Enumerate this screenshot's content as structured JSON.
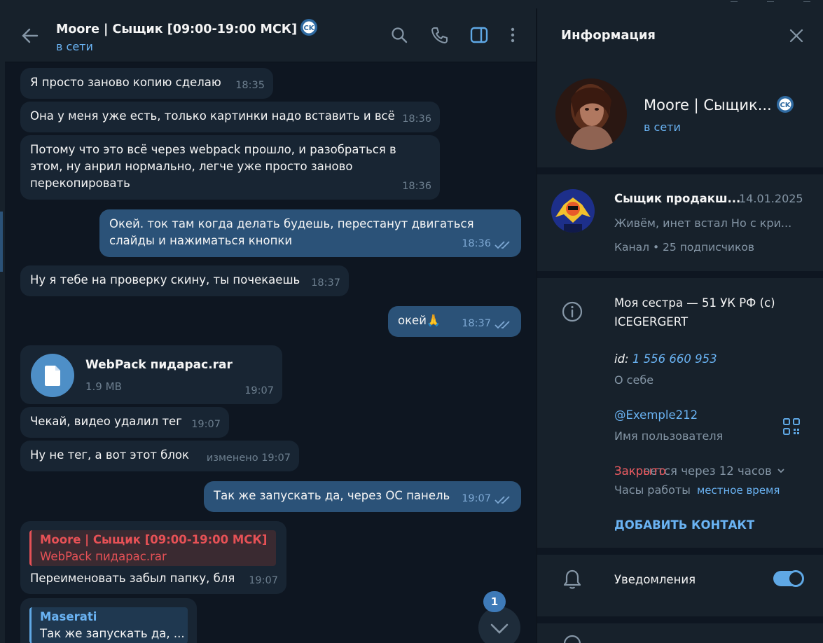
{
  "chat": {
    "title": "Moore | Сыщик [09:00-19:00 МСК]",
    "status": "в сети",
    "messages": [
      {
        "text": "Я просто заново копию сделаю",
        "time": "18:35"
      },
      {
        "text": "Она у меня уже есть, только картинки надо вставить и всё",
        "time": "18:36"
      },
      {
        "lines": [
          "Потому что это всё через webpack прошло, и разобраться в",
          "этом, ну анрил нормально, легче уже просто заново",
          "перекопировать"
        ],
        "time": "18:36"
      },
      {
        "lines": [
          "Окей. ток там когда делать будешь, перестанут двигаться",
          "слайды и нажиматься кнопки"
        ],
        "time": "18:36"
      },
      {
        "text": "Ну я тебе на проверку скину, ты почекаешь",
        "time": "18:37"
      },
      {
        "text": "окей🙏",
        "time": "18:37"
      },
      {
        "file_name": "WebPack пидарас.rar",
        "file_size": "1.9 MB",
        "time": "19:07"
      },
      {
        "text": "Чекай, видео удалил тег",
        "time": "19:07"
      },
      {
        "text": "Ну не тег, а вот этот блок",
        "time": "изменено 19:07"
      },
      {
        "text": "Так же запускать да, через ОС панель",
        "time": "19:07"
      },
      {
        "reply_name": "Moore | Сыщик [09:00-19:00 МСК]",
        "reply_text": "WebPack пидарас.rar",
        "text": "Переименовать забыл папку, бля",
        "time": "19:07"
      },
      {
        "reply_name": "Maserati",
        "reply_text": "Так же запускать да, ..."
      }
    ],
    "unread_count": "1"
  },
  "info": {
    "title": "Информация",
    "name": "Moore | Сыщик...",
    "status": "в сети",
    "channel": {
      "name": "Сыщик продакш...",
      "date": "14.01.2025",
      "preview": "Живём, инет встал  Но с кри...",
      "meta": "Канал • 25 подписчиков"
    },
    "bio_line1": "Моя сестра — 51 УК РФ (с)",
    "bio_line2": "ICEGERGERT",
    "id_prefix": "id:",
    "id_value": "1 556 660 953",
    "about_label": "О себе",
    "username": "@Exemple212",
    "username_label": "Имя пользователя",
    "hours_overlap": "Закрыто",
    "hours_status": "Закроется через 12 часов",
    "hours_label": "Часы работы",
    "local_time": "местное время",
    "add_contact": "ДОБАВИТЬ КОНТАКТ",
    "notifications": "Уведомления",
    "notifications_on": true
  },
  "colors": {
    "background": "#0e1621",
    "panel": "#17212b",
    "incoming_bubble": "#182533",
    "outgoing_bubble": "#2b5278",
    "accent": "#6ab3f3",
    "reply_red": "#e65156"
  }
}
